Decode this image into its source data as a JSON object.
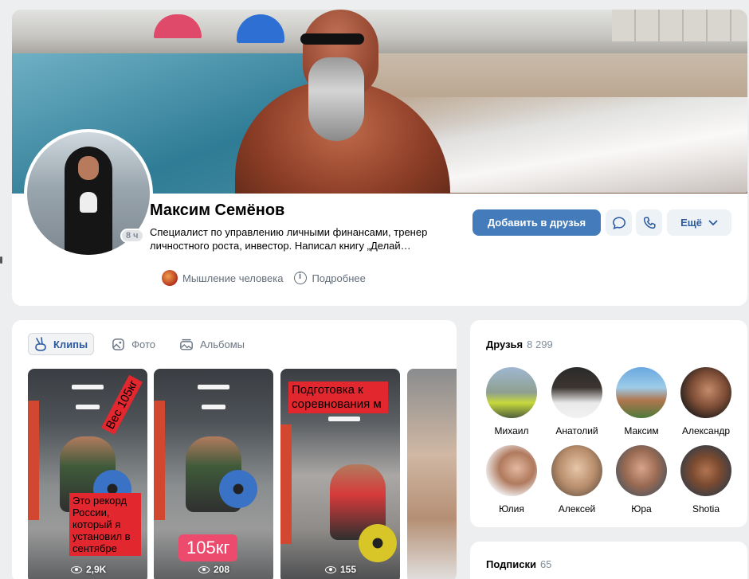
{
  "profile": {
    "name": "Максим Семёнов",
    "status": "Специалист по управлению личными финансами, тренер личностного роста, инвестор. Написал книгу „Делай…",
    "online": "8 ч",
    "community": "Мышление человека",
    "details": "Подробнее",
    "add_friend": "Добавить в друзья",
    "more": "Ещё"
  },
  "tabs": [
    {
      "label": "Клипы",
      "icon": "clip-icon"
    },
    {
      "label": "Фото",
      "icon": "photo-icon"
    },
    {
      "label": "Альбомы",
      "icon": "albums-icon"
    }
  ],
  "clips": [
    {
      "caption_top": "Вес 105кг",
      "caption_bottom": "Это рекорд России, который я установил в сентябре",
      "views": "2,9K"
    },
    {
      "caption_big": "105кг",
      "views": "208"
    },
    {
      "caption_top": "Подготовка к соревнования м",
      "views": "155"
    }
  ],
  "friends": {
    "title": "Друзья",
    "count": "8 299",
    "list": [
      "Михаил",
      "Анатолий",
      "Максим",
      "Александр",
      "Юлия",
      "Алексей",
      "Юра",
      "Shotia"
    ]
  },
  "subscriptions": {
    "title": "Подписки",
    "count": "65"
  },
  "colors": {
    "accent": "#447bba",
    "link": "#2c5aa0",
    "background": "#edeef0"
  }
}
